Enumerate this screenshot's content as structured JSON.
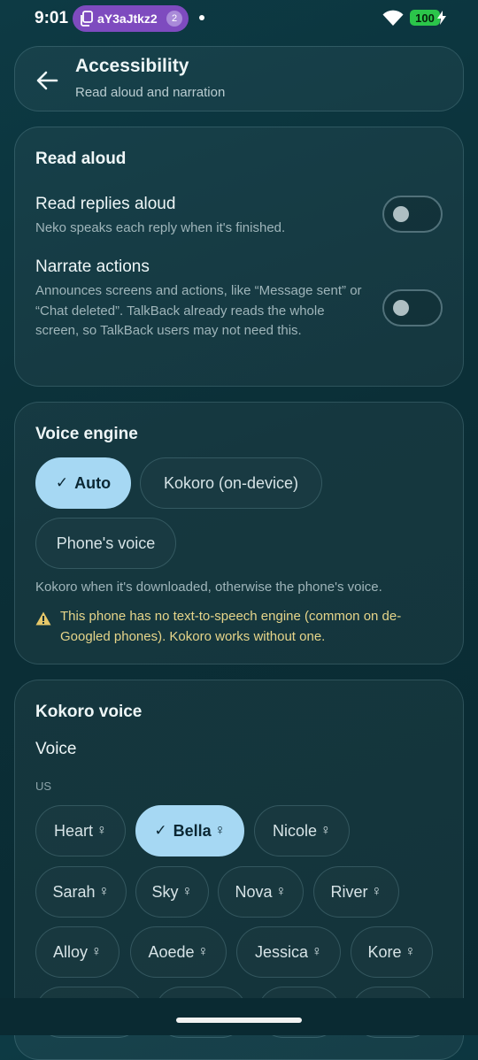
{
  "status_bar": {
    "time": "9:01",
    "notification_chip_text": "aY3aJtkz2",
    "notification_count": "2",
    "battery": "100"
  },
  "header": {
    "title": "Accessibility",
    "subtitle": "Read aloud and narration"
  },
  "read_aloud": {
    "title": "Read aloud",
    "read_replies": {
      "label": "Read replies aloud",
      "description": "Neko speaks each reply when it's finished.",
      "enabled": false
    },
    "narrate_actions": {
      "label": "Narrate actions",
      "description": "Announces screens and actions, like “Message sent” or “Chat deleted”. TalkBack already reads the whole screen, so TalkBack users may not need this.",
      "enabled": false
    }
  },
  "voice_engine": {
    "title": "Voice engine",
    "options": [
      "Auto",
      "Kokoro (on-device)",
      "Phone's voice"
    ],
    "selected": "Auto",
    "note": "Kokoro when it's downloaded, otherwise the phone's voice.",
    "warning": "This phone has no text-to-speech engine (common on de-Googled phones). Kokoro works without one."
  },
  "kokoro_voice": {
    "title": "Kokoro voice",
    "subtitle": "Voice",
    "group_label": "US",
    "voices": [
      "Heart",
      "Bella",
      "Nicole",
      "Sarah",
      "Sky",
      "Nova",
      "River",
      "Alloy",
      "Aoede",
      "Jessica",
      "Kore"
    ],
    "selected": "Bella",
    "gender_symbol": "♀"
  },
  "colors": {
    "accent": "#a6d8f3",
    "background": "#0b2f37",
    "warning": "#e6d58a"
  }
}
